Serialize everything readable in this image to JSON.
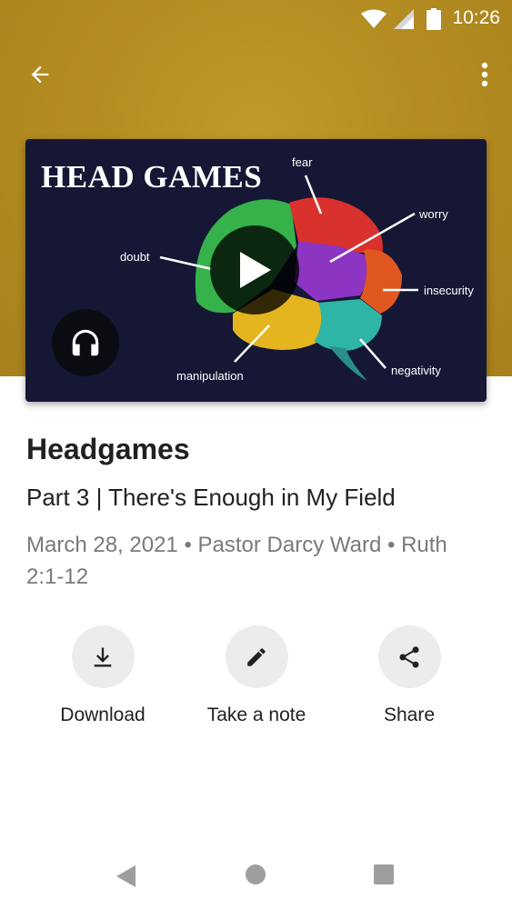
{
  "status_bar": {
    "time": "10:26",
    "icons": [
      "wifi-icon",
      "signal-icon",
      "battery-icon"
    ]
  },
  "app_bar": {
    "back_icon": "arrow-back-icon",
    "menu_icon": "more-vert-icon"
  },
  "media": {
    "artwork_title": "HEAD GAMES",
    "artwork_labels": {
      "fear": "fear",
      "worry": "worry",
      "doubt": "doubt",
      "insecurity": "insecurity",
      "manipulation": "manipulation",
      "negativity": "negativity"
    },
    "play_icon": "play-icon",
    "audio_icon": "headphones-icon"
  },
  "sermon": {
    "title": "Headgames",
    "subtitle": "Part 3 | There's Enough in My Field",
    "meta": "March 28, 2021 • Pastor Darcy Ward • Ruth 2:1-12"
  },
  "actions": [
    {
      "label": "Download",
      "icon": "download-icon"
    },
    {
      "label": "Take a note",
      "icon": "pencil-icon"
    },
    {
      "label": "Share",
      "icon": "share-icon"
    }
  ],
  "nav_bar": {
    "icons": [
      "nav-back-icon",
      "nav-home-icon",
      "nav-recents-icon"
    ]
  },
  "colors": {
    "header": "#b48d22",
    "artwork_bg": "#151735",
    "text_primary": "#212121",
    "text_secondary": "#7a7a7a",
    "action_circle": "#ececec"
  }
}
